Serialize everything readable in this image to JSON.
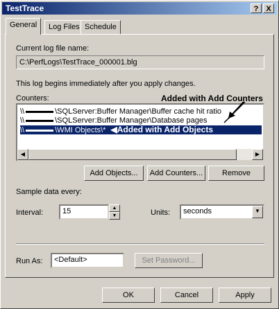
{
  "window": {
    "title": "TestTrace"
  },
  "title_buttons": {
    "help": "?",
    "close": "X"
  },
  "tabs": [
    {
      "label": "General"
    },
    {
      "label": "Log Files"
    },
    {
      "label": "Schedule"
    }
  ],
  "general": {
    "current_log_label": "Current log file name:",
    "current_log_value": "C:\\PerfLogs\\TestTrace_000001.blg",
    "info_text": "This log begins immediately after you apply changes.",
    "counters_label": "Counters:",
    "counters": [
      {
        "prefix": "\\\\",
        "path": "\\SQLServer:Buffer Manager\\Buffer cache hit ratio",
        "selected": false
      },
      {
        "prefix": "\\\\",
        "path": "\\SQLServer:Buffer Manager\\Database pages",
        "selected": false
      },
      {
        "prefix": "\\\\",
        "path": "\\WMI Objects\\*",
        "selected": true
      }
    ],
    "annotation_counters": "Added with Add Counters",
    "annotation_objects": "Added with Add Objects",
    "add_objects_label": "Add Objects...",
    "add_counters_label": "Add Counters...",
    "remove_label": "Remove",
    "sample_label": "Sample data every:",
    "interval_label": "Interval:",
    "interval_value": "15",
    "units_label": "Units:",
    "units_value": "seconds",
    "run_as_label": "Run As:",
    "run_as_value": "<Default>",
    "set_password_label": "Set Password..."
  },
  "dialog_buttons": {
    "ok": "OK",
    "cancel": "Cancel",
    "apply": "Apply"
  }
}
